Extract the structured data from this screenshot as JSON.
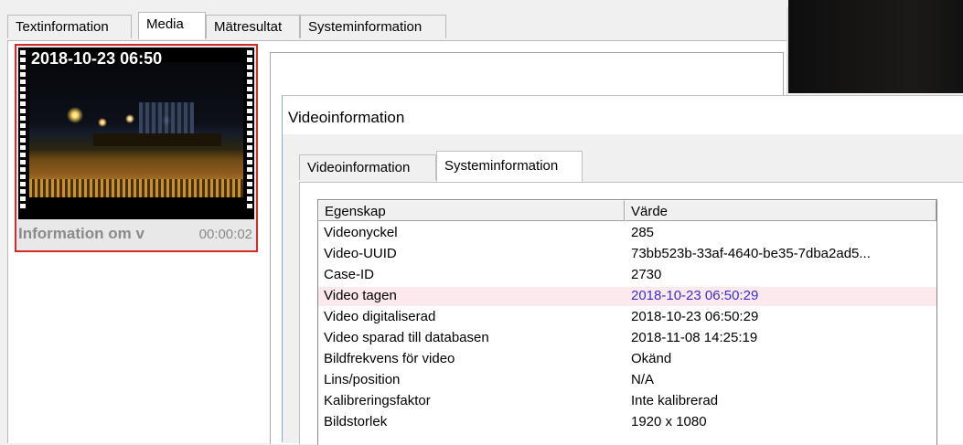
{
  "outer": {
    "tabs": [
      {
        "label": "Textinformation",
        "selected": false
      },
      {
        "label": "Media",
        "selected": true
      },
      {
        "label": "Mätresultat",
        "selected": false
      },
      {
        "label": "Systeminformation",
        "selected": false
      }
    ],
    "media_item": {
      "timestamp": "2018-10-23 06:50",
      "caption": "Information om v",
      "duration": "00:00:02",
      "border_color": "#d42a2a"
    }
  },
  "dialog": {
    "title": "Videoinformation",
    "tabs": [
      {
        "label": "Videoinformation",
        "selected": false
      },
      {
        "label": "Systeminformation",
        "selected": true
      }
    ],
    "table": {
      "columns": [
        "Egenskap",
        "Värde"
      ],
      "rows": [
        {
          "property": "Videonyckel",
          "value": "285"
        },
        {
          "property": "Video-UUID",
          "value": "73bb523b-33af-4640-be35-7dba2ad5..."
        },
        {
          "property": "Case-ID",
          "value": "2730"
        },
        {
          "property": "Video tagen",
          "value": "2018-10-23 06:50:29",
          "highlighted": true
        },
        {
          "property": "Video digitaliserad",
          "value": "2018-10-23 06:50:29"
        },
        {
          "property": "Video sparad till databasen",
          "value": "2018-11-08 14:25:19"
        },
        {
          "property": "Bildfrekvens för video",
          "value": "Okänd"
        },
        {
          "property": "Lins/position",
          "value": "N/A"
        },
        {
          "property": "Kalibreringsfaktor",
          "value": "Inte kalibrerad"
        },
        {
          "property": "Bildstorlek",
          "value": "1920 x 1080"
        }
      ]
    },
    "highlight_color": "#fbe9ee",
    "highlight_text_color": "#3b2fc9"
  }
}
